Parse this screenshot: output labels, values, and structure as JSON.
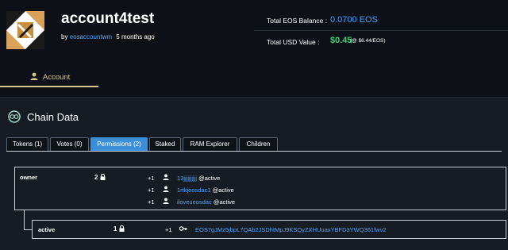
{
  "account": {
    "name": "account4test",
    "by_prefix": "by",
    "creator": "eosaccountwm",
    "created_ago": "5 months ago"
  },
  "balances": {
    "eos_label": "Total EOS Balance :",
    "eos_value": "0.0700 EOS",
    "usd_label": "Total USD Value :",
    "usd_value": "$0.45",
    "usd_rate": "(@ $6.44/EOS)"
  },
  "nav": {
    "account_tab": "Account"
  },
  "chain": {
    "title": "Chain Data",
    "tabs": [
      "Tokens (1)",
      "Votes (0)",
      "Permissions (2)",
      "Staked",
      "RAM Explorer",
      "Children"
    ],
    "active_tab": "Permissions (2)"
  },
  "permissions": {
    "owner": {
      "name": "owner",
      "threshold": "2",
      "accounts": [
        {
          "weight": "+1",
          "actor": "13jjjjjjjjjj",
          "perm": "@active"
        },
        {
          "weight": "+1",
          "actor": "1rtkjeosdac1",
          "perm": "@active"
        },
        {
          "weight": "+1",
          "actor": "iloveueosdac",
          "perm": "@active"
        }
      ]
    },
    "active": {
      "name": "active",
      "threshold": "1",
      "keys": [
        {
          "weight": "+1",
          "key": "EOS7gJMz5jbpL7QAb2JSDhtMpJ9KSQyZXHUuaxYBFD3YWQ361fwv2"
        }
      ]
    }
  },
  "colors": {
    "link": "#4aa3ff",
    "accent_gold": "#d8c58a",
    "usd_green": "#3ad37a",
    "active_tab": "#3a8fd8"
  },
  "icons": [
    "user-icon",
    "lock-icon",
    "key-icon",
    "chain-data-icon"
  ]
}
